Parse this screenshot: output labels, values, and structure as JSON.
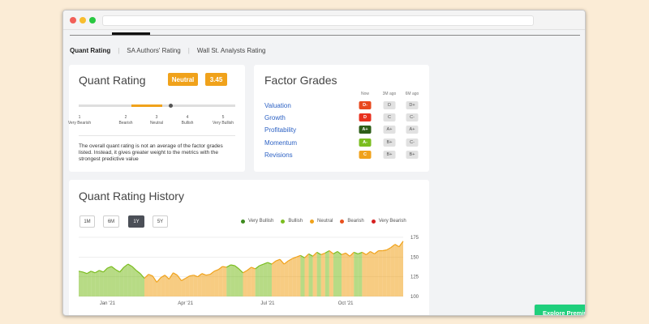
{
  "tabs": [
    "Quant Rating",
    "SA Authors' Rating",
    "Wall St. Analysts Rating"
  ],
  "quant": {
    "title": "Quant Rating",
    "badge": "Neutral",
    "score": "3.45",
    "score_value": 3.45,
    "scale": [
      {
        "num": "1",
        "label": "Very Bearish"
      },
      {
        "num": "2",
        "label": "Bearish"
      },
      {
        "num": "3",
        "label": "Neutral"
      },
      {
        "num": "4",
        "label": "Bullish"
      },
      {
        "num": "5",
        "label": "Very Bullish"
      }
    ],
    "note": "The overall quant rating is not an average of the factor grades listed. Instead, it gives greater weight to the metrics with the strongest predictive value"
  },
  "factor": {
    "title": "Factor Grades",
    "cols": [
      "Now",
      "3M ago",
      "6M ago"
    ],
    "rows": [
      {
        "label": "Valuation",
        "now": "D-",
        "m3": "D",
        "m6": "D+",
        "color": "#e8491e"
      },
      {
        "label": "Growth",
        "now": "D",
        "m3": "C",
        "m6": "C-",
        "color": "#e8301e"
      },
      {
        "label": "Profitability",
        "now": "A+",
        "m3": "A+",
        "m6": "A+",
        "color": "#2d5d17"
      },
      {
        "label": "Momentum",
        "now": "A-",
        "m3": "B+",
        "m6": "C-",
        "color": "#7bbd20"
      },
      {
        "label": "Revisions",
        "now": "C",
        "m3": "B+",
        "m6": "B+",
        "color": "#f0a21b"
      }
    ]
  },
  "history": {
    "title": "Quant Rating History",
    "ranges": [
      "1M",
      "6M",
      "1Y",
      "5Y"
    ],
    "active_range": "1Y",
    "legend": [
      {
        "label": "Very Bullish",
        "color": "#3d8a1d"
      },
      {
        "label": "Bullish",
        "color": "#7bbd20"
      },
      {
        "label": "Neutral",
        "color": "#f0a21b"
      },
      {
        "label": "Bearish",
        "color": "#e8501e"
      },
      {
        "label": "Very Bearish",
        "color": "#d62020"
      }
    ]
  },
  "chart_data": {
    "type": "area",
    "title": "Quant Rating History",
    "xlabel": "",
    "ylabel": "",
    "x_ticks": [
      "Jan '21",
      "Apr '21",
      "Jul '21",
      "Oct '21"
    ],
    "y_ticks": [
      100,
      125,
      150,
      175
    ],
    "ylim": [
      100,
      178
    ],
    "grid": true,
    "price": [
      132,
      131,
      129,
      132,
      130,
      133,
      131,
      136,
      138,
      134,
      131,
      137,
      141,
      138,
      133,
      129,
      123,
      128,
      126,
      118,
      124,
      127,
      122,
      130,
      127,
      120,
      123,
      126,
      127,
      125,
      129,
      127,
      128,
      132,
      134,
      138,
      137,
      140,
      139,
      135,
      130,
      133,
      137,
      135,
      139,
      141,
      143,
      141,
      145,
      147,
      141,
      145,
      148,
      150,
      152,
      149,
      154,
      151,
      156,
      153,
      155,
      158,
      154,
      157,
      153,
      155,
      151,
      156,
      154,
      156,
      153,
      157,
      154,
      158,
      158,
      159,
      162,
      166,
      163,
      170
    ],
    "ratings": [
      "B",
      "B",
      "B",
      "B",
      "B",
      "B",
      "B",
      "B",
      "B",
      "B",
      "B",
      "B",
      "B",
      "B",
      "B",
      "B",
      "N",
      "N",
      "N",
      "N",
      "N",
      "N",
      "N",
      "N",
      "N",
      "N",
      "N",
      "N",
      "N",
      "N",
      "N",
      "N",
      "N",
      "N",
      "N",
      "N",
      "B",
      "B",
      "B",
      "B",
      "N",
      "N",
      "N",
      "B",
      "B",
      "B",
      "B",
      "N",
      "N",
      "N",
      "N",
      "N",
      "N",
      "N",
      "B",
      "N",
      "B",
      "N",
      "B",
      "N",
      "B",
      "N",
      "B",
      "B",
      "N",
      "N",
      "N",
      "B",
      "B",
      "N",
      "N",
      "N",
      "N",
      "N",
      "N",
      "N",
      "N",
      "N",
      "N",
      "N"
    ]
  },
  "cta": "Explore Premium Features"
}
